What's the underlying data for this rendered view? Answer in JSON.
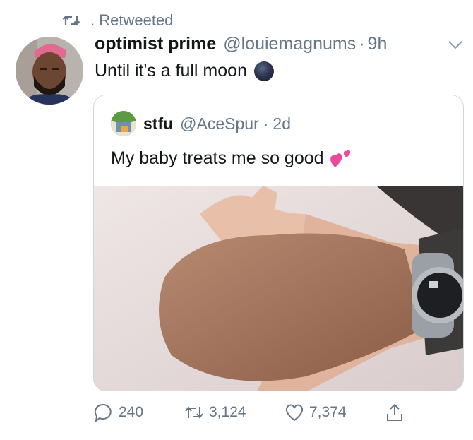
{
  "retweet": {
    "label": ". Retweeted",
    "icon": "retweet-icon"
  },
  "tweet": {
    "author_name": "optimist prime",
    "author_handle": "@louiemagnums",
    "separator": "·",
    "time": "9h",
    "text": "Until it's a full moon",
    "emoji": "new-moon-emoji"
  },
  "quoted": {
    "author_name": "stfu",
    "author_handle": "@AceSpur",
    "separator": "·",
    "time": "2d",
    "text": "My baby treats me so good",
    "emoji": "two-hearts-emoji"
  },
  "actions": {
    "replies": "240",
    "retweets": "3,124",
    "likes": "7,374"
  },
  "colors": {
    "text": "#14171a",
    "secondary": "#657786",
    "border": "#ccd6dd"
  }
}
